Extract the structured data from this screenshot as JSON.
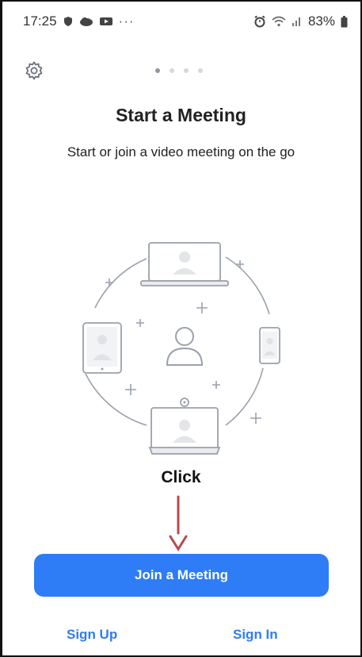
{
  "status_bar": {
    "time": "17:25",
    "left_icons": [
      "shield-icon",
      "cloud-icon",
      "youtube-icon"
    ],
    "more": "···",
    "right_icons": [
      "alarm-icon",
      "wifi-icon",
      "signal-icon"
    ],
    "battery": "83%"
  },
  "settings": {
    "icon": "gear-icon"
  },
  "pager": {
    "count": 4,
    "active_index": 0
  },
  "onboarding": {
    "title": "Start a Meeting",
    "subtitle": "Start or join a video meeting on the go"
  },
  "annotation": {
    "label": "Click",
    "arrow_color": "#b84a4a"
  },
  "actions": {
    "join_label": "Join a Meeting",
    "sign_up_label": "Sign Up",
    "sign_in_label": "Sign In"
  },
  "colors": {
    "accent": "#2e7cf6",
    "illustration_stroke": "#9aa1ab"
  }
}
